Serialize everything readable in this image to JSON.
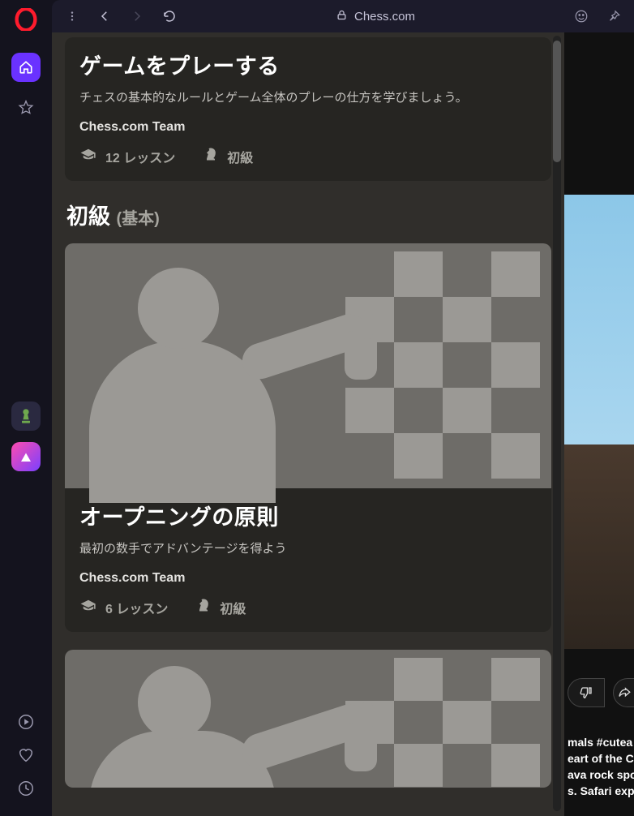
{
  "browser": {
    "address_label": "Chess.com"
  },
  "lessons": {
    "card0": {
      "title": "ゲームをプレーする",
      "subtitle": "チェスの基本的なルールとゲーム全体のプレーの仕方を学びましょう。",
      "author": "Chess.com Team",
      "lessons": "12 レッスン",
      "level": "初級"
    },
    "section1": {
      "title": "初級",
      "sub": "(基本)"
    },
    "card1": {
      "title": "オープニングの原則",
      "subtitle": "最初の数手でアドバンテージを得よう",
      "author": "Chess.com Team",
      "lessons": "6 レッスン",
      "level": "初級"
    }
  },
  "background": {
    "hashtags": "mals #cutea",
    "line1": "eart of the C",
    "line2": "ava rock spo",
    "line3": "s. Safari exp"
  }
}
